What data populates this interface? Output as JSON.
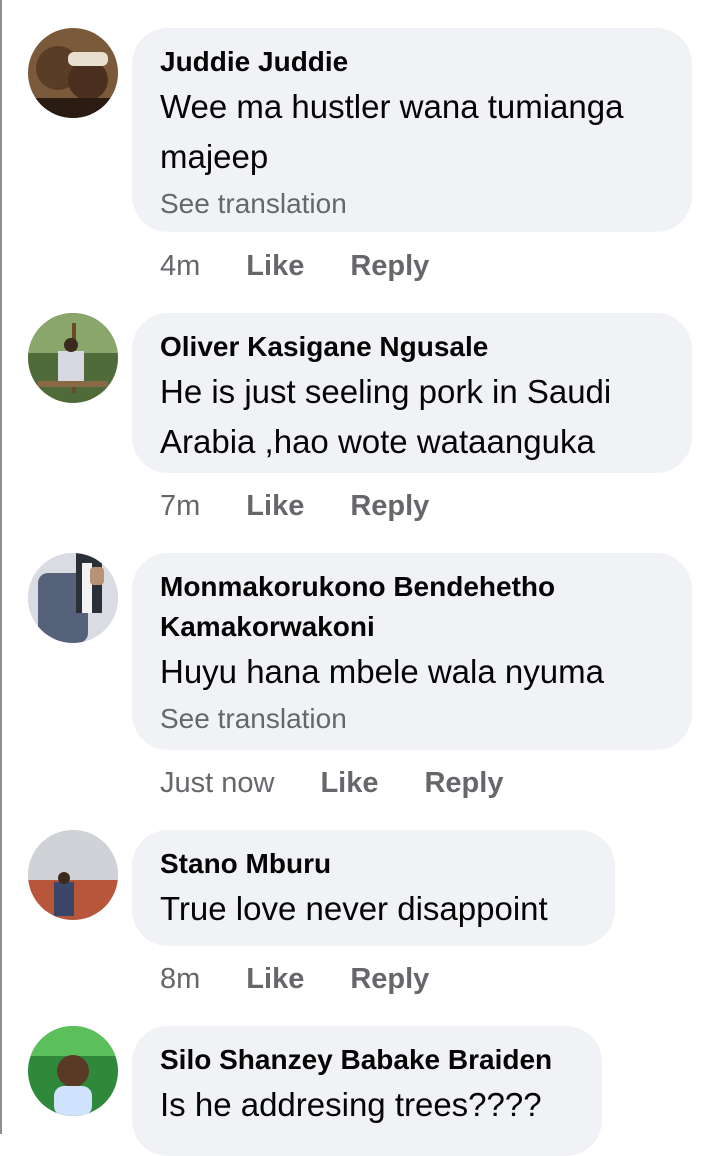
{
  "comments": [
    {
      "author": "Juddie Juddie",
      "text": "Wee ma hustler wana tumianga majeep",
      "see_translation": "See translation",
      "time": "4m",
      "like": "Like",
      "reply": "Reply"
    },
    {
      "author": "Oliver Kasigane Ngusale",
      "text": "He is just seeling pork in Saudi Arabia ,hao wote wataanguka",
      "time": "7m",
      "like": "Like",
      "reply": "Reply"
    },
    {
      "author": "Monmakorukono Bendehetho Kamakorwakoni",
      "text": "Huyu hana mbele wala nyuma",
      "see_translation": "See translation",
      "time": "Just now",
      "like": "Like",
      "reply": "Reply"
    },
    {
      "author": "Stano Mburu",
      "text": "True love never disappoint",
      "time": "8m",
      "like": "Like",
      "reply": "Reply"
    },
    {
      "author": "Silo Shanzey Babake Braiden",
      "text": "Is he addresing trees????"
    }
  ],
  "colors": {
    "bubble": "#f0f2f5",
    "meta": "#65676b",
    "text": "#050505"
  }
}
